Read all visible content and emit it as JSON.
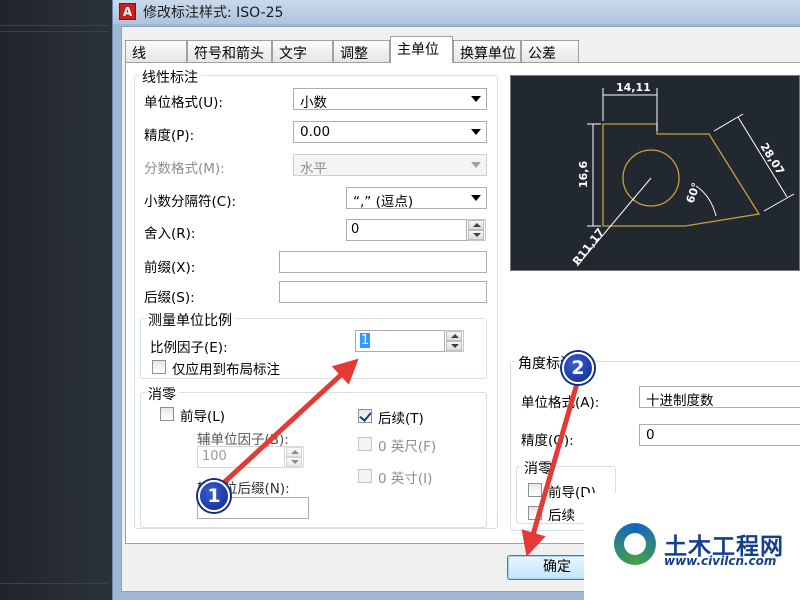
{
  "window": {
    "title": "修改标注样式: ISO-25"
  },
  "tabs": [
    {
      "label": "线",
      "active": false
    },
    {
      "label": "符号和箭头",
      "active": false
    },
    {
      "label": "文字",
      "active": false
    },
    {
      "label": "调整",
      "active": false
    },
    {
      "label": "主单位",
      "active": true
    },
    {
      "label": "换算单位",
      "active": false
    },
    {
      "label": "公差",
      "active": false
    }
  ],
  "linear": {
    "group_title": "线性标注",
    "unit_format_label": "单位格式(U):",
    "unit_format_value": "小数",
    "precision_label": "精度(P):",
    "precision_value": "0.00",
    "fraction_format_label": "分数格式(M):",
    "fraction_format_value": "水平",
    "decimal_separator_label": "小数分隔符(C):",
    "decimal_separator_value": "“,” (逗点)",
    "round_off_label": "舍入(R):",
    "round_off_value": "0",
    "prefix_label": "前缀(X):",
    "prefix_value": "",
    "suffix_label": "后缀(S):",
    "suffix_value": ""
  },
  "measurement_scale": {
    "group_title": "测量单位比例",
    "scale_factor_label": "比例因子(E):",
    "scale_factor_value": "1",
    "apply_layout_label": "仅应用到布局标注",
    "apply_layout_checked": false
  },
  "zero_suppression": {
    "group_title": "消零",
    "leading_label": "前导(L)",
    "leading_checked": false,
    "trailing_label": "后续(T)",
    "trailing_checked": true,
    "sub_unit_factor_label": "辅单位因子(B):",
    "sub_unit_factor_value": "100",
    "sub_unit_suffix_label": "辅单位后缀(N):",
    "sub_unit_suffix_value": "",
    "feet_label": "0 英尺(F)",
    "inches_label": "0 英寸(I)"
  },
  "angular": {
    "group_title": "角度标注",
    "unit_format_label": "单位格式(A):",
    "unit_format_value": "十进制度数",
    "precision_label": "精度(O):",
    "precision_value": "0",
    "zero_group_title": "消零",
    "leading_label": "前导(D)",
    "trailing_label": "后续"
  },
  "preview": {
    "dim_top": "14,11",
    "dim_left": "16,6",
    "dim_right": "28,07",
    "dim_angle": "60°",
    "dim_radius": "R11,17"
  },
  "buttons": {
    "ok": "确定"
  },
  "callouts": {
    "one": "1",
    "two": "2"
  },
  "watermark": {
    "name": "土木工程网",
    "url": "www.civilcn.com"
  },
  "colors": {
    "preview_bg": "#212830",
    "preview_geometry": "#c8a03a",
    "preview_dims": "#ffffff",
    "annotation_arrow": "#e53935",
    "callout_badge": "#0d2a8c"
  }
}
